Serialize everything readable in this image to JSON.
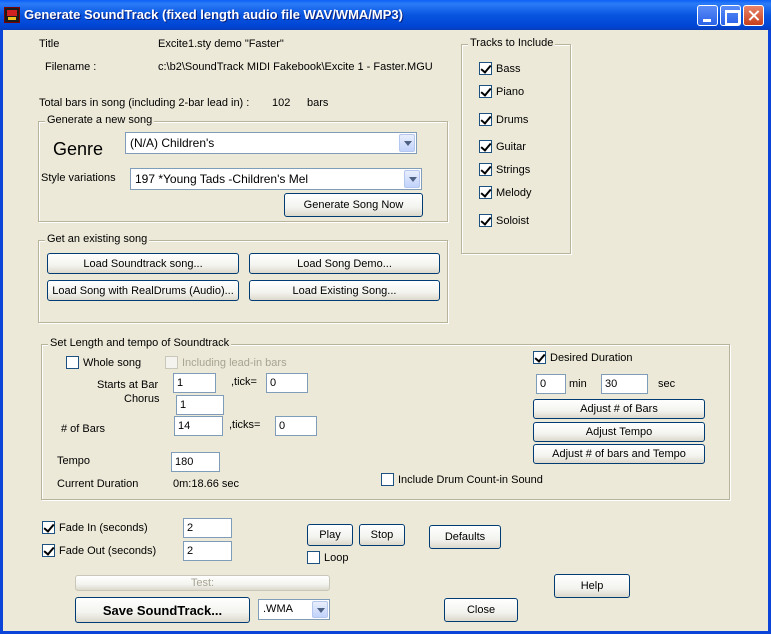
{
  "window": {
    "title": "Generate SoundTrack (fixed length audio file WAV/WMA/MP3)",
    "icon": "app-icon"
  },
  "info": {
    "title_label": "Title",
    "title_value": "Excite1.sty demo \"Faster\"",
    "filename_label": "Filename :",
    "filename_value": "c:\\b2\\SoundTrack MIDI Fakebook\\Excite 1 - Faster.MGU",
    "total_bars_label": "Total bars in song (including 2-bar lead in) :",
    "total_bars_value": "102",
    "total_bars_unit": "bars"
  },
  "generate": {
    "group_label": "Generate a new song",
    "genre_label": "Genre",
    "genre_value": "(N/A) Children's",
    "style_label": "Style variations",
    "style_value": "197 *Young Tads -Children's Mel",
    "generate_button": "Generate Song Now"
  },
  "existing": {
    "group_label": "Get an existing song",
    "load_soundtrack": "Load Soundtrack song...",
    "load_demo": "Load Song Demo...",
    "load_realdrums": "Load Song with RealDrums (Audio)...",
    "load_existing": "Load Existing Song..."
  },
  "tracks": {
    "group_label": "Tracks to Include",
    "items": [
      {
        "label": "Bass",
        "checked": true
      },
      {
        "label": "Piano",
        "checked": true
      },
      {
        "label": "Drums",
        "checked": true
      },
      {
        "label": "Guitar",
        "checked": true
      },
      {
        "label": "Strings",
        "checked": true
      },
      {
        "label": "Melody",
        "checked": true
      },
      {
        "label": "Soloist",
        "checked": true
      }
    ]
  },
  "length": {
    "group_label": "Set Length and tempo of Soundtrack",
    "whole_song": "Whole song",
    "including_leadin": "Including lead-in bars",
    "starts_label": "Starts at Bar",
    "starts_value": "1",
    "tick_label": ",tick=",
    "tick_value": "0",
    "chorus_label": "Chorus",
    "chorus_value": "1",
    "bars_label": "# of Bars",
    "bars_value": "14",
    "ticks_label": ",ticks=",
    "ticks_value": "0",
    "tempo_label": "Tempo",
    "tempo_value": "180",
    "duration_label": "Current Duration",
    "duration_value": "0m:18.66 sec",
    "desired_duration": "Desired Duration",
    "min_value": "0",
    "min_label": "min",
    "sec_value": "30",
    "sec_label": "sec",
    "adjust_bars": "Adjust # of Bars",
    "adjust_tempo": "Adjust Tempo",
    "adjust_both": "Adjust # of bars and Tempo",
    "drum_countin": "Include Drum Count-in Sound"
  },
  "fade": {
    "fade_in_label": "Fade In (seconds)",
    "fade_in_value": "2",
    "fade_out_label": "Fade Out  (seconds)",
    "fade_out_value": "2"
  },
  "controls": {
    "play": "Play",
    "stop": "Stop",
    "loop": "Loop",
    "defaults": "Defaults",
    "test": "Test:",
    "help": "Help",
    "save": "Save SoundTrack...",
    "format_value": ".WMA",
    "close": "Close"
  }
}
